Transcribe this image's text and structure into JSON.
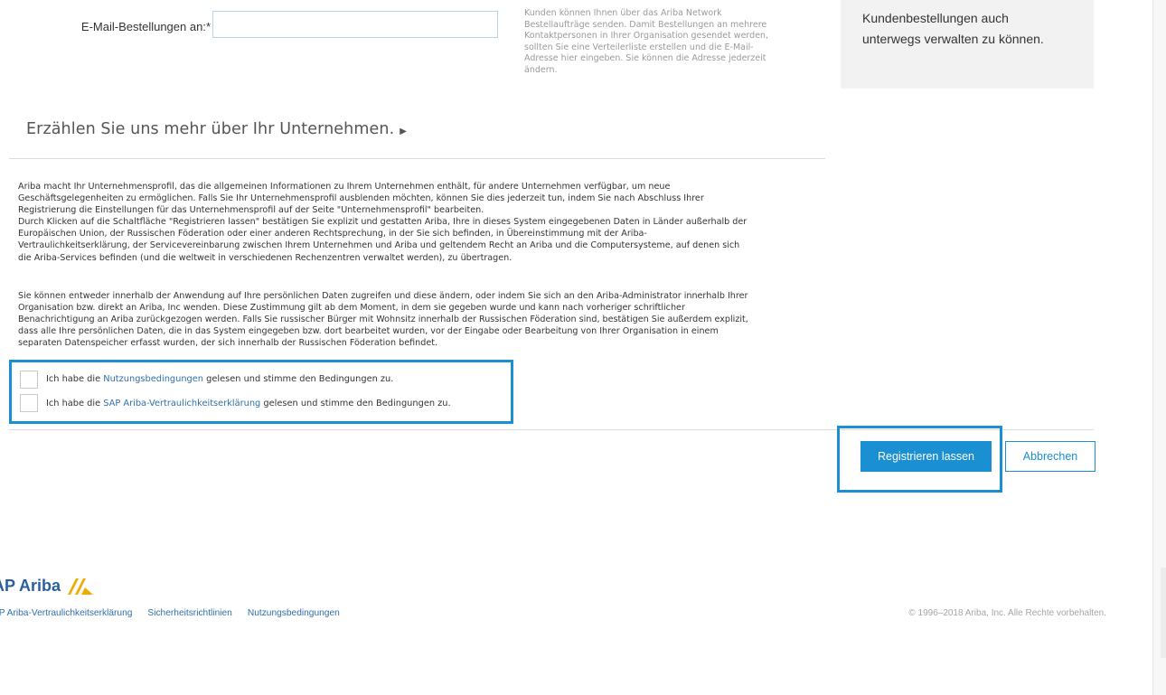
{
  "email_section": {
    "label": "E-Mail-Bestellungen an:",
    "required_marker": "*",
    "input_value": "",
    "help_lines": [
      "Kunden können Ihnen über das Ariba Network",
      "Bestellaufträge senden. Damit Bestellungen an mehrere",
      "Kontaktpersonen in Ihrer Organisation gesendet werden,",
      "sollten Sie eine Verteilerliste erstellen und die E-Mail-",
      "Adresse hier eingeben. Sie können die Adresse jederzeit",
      "ändern."
    ]
  },
  "side_panel": {
    "lines": [
      "Kundenbestellungen auch",
      "unterwegs verwalten zu können."
    ]
  },
  "section": {
    "title": "Erzählen Sie uns mehr über Ihr Unternehmen.",
    "arrow": "▶"
  },
  "legal": {
    "para1_lines": [
      "Ariba macht Ihr Unternehmensprofil, das die allgemeinen Informationen zu Ihrem Unternehmen enthält, für andere Unternehmen verfügbar, um neue",
      "Geschäftsgelegenheiten zu ermöglichen. Falls Sie Ihr Unternehmensprofil ausblenden möchten, können Sie dies jederzeit tun, indem Sie nach Abschluss Ihrer",
      "Registrierung die Einstellungen für das Unternehmensprofil auf der Seite \"Unternehmensprofil\" bearbeiten.",
      "Durch Klicken auf die Schaltfläche \"Registrieren lassen\" bestätigen Sie explizit und gestatten Ariba, Ihre in dieses System eingegebenen Daten in Länder außerhalb der",
      "Europäischen Union, der Russischen Föderation oder einer anderen Rechtsprechung, in der Sie sich befinden, in Übereinstimmung mit der Ariba-",
      "Vertraulichkeitserklärung, der Servicevereinbarung zwischen Ihrem Unternehmen und Ariba und geltendem Recht an Ariba und die Computersysteme, auf denen sich",
      "die Ariba-Services befinden (und die weltweit in verschiedenen Rechenzentren verwaltet werden), zu übertragen."
    ],
    "para2_lines": [
      "Sie können entweder innerhalb der Anwendung auf Ihre persönlichen Daten zugreifen und diese ändern, oder indem Sie sich an den Ariba-Administrator innerhalb Ihrer",
      "Organisation bzw. direkt an Ariba, Inc wenden. Diese Zustimmung gilt ab dem Moment, in dem sie gegeben wurde und kann nach vorheriger schriftlicher",
      "Benachrichtigung an Ariba zurückgezogen werden. Falls Sie russischer Bürger mit Wohnsitz innerhalb der Russischen Föderation sind, bestätigen Sie außerdem explizit,",
      "dass alle Ihre persönlichen Daten, die in das System eingegeben bzw. dort bearbeitet wurden, vor der Eingabe oder Bearbeitung von Ihrer Organisation in einem",
      "separaten Datenspeicher erfasst wurden, der sich innerhalb der Russischen Föderation befindet."
    ]
  },
  "terms": {
    "item1": {
      "prefix": "Ich habe die ",
      "link": "Nutzungsbedingungen",
      "suffix": " gelesen und stimme den Bedingungen zu.",
      "checked": false
    },
    "item2": {
      "prefix": "Ich habe die ",
      "link": "SAP Ariba-Vertraulichkeitserklärung",
      "suffix": " gelesen und stimme den Bedingungen zu.",
      "checked": false
    }
  },
  "actions": {
    "register": "Registrieren lassen",
    "cancel": "Abbrechen"
  },
  "footer": {
    "brand": "AP Ariba",
    "links": [
      "AP Ariba-Vertraulichkeitserklärung",
      "Sicherheitsrichtlinien",
      "Nutzungsbedingungen"
    ],
    "copyright": "© 1996–2018 Ariba, Inc. Alle Rechte vorbehalten."
  },
  "colors": {
    "accent": "#1a8fd1",
    "link": "#2f6fa8",
    "brand_gold": "#f0ab00"
  }
}
